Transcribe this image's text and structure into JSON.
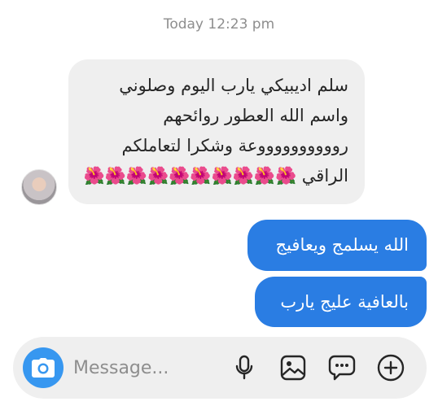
{
  "thread": {
    "timestamp": "Today 12:23 pm"
  },
  "messages": {
    "incoming": {
      "lines": [
        "سلم اديبيكي يارب اليوم وصلوني",
        "واسم الله العطور روائحهم",
        "رووووووووووعة وشكرا لتعاملكم",
        "الراقي 🌺🌺🌺🌺🌺🌺🌺🌺🌺🌺"
      ]
    },
    "outgoing": [
      {
        "text": "الله يسلمج ويعافيج"
      },
      {
        "text": "بالعافية عليج يارب"
      }
    ]
  },
  "composer": {
    "placeholder": "Message...",
    "value": ""
  },
  "icons": {
    "camera": "camera-icon",
    "microphone": "microphone-icon",
    "gallery": "image-icon",
    "sticker": "chat-bubble-icon",
    "more": "plus-icon",
    "avatar": "contact-avatar"
  },
  "colors": {
    "outgoing_bubble": "#2a7de3",
    "incoming_bubble": "#efefef",
    "camera_button": "#3797f0",
    "timestamp_text": "#8e8e8e"
  }
}
